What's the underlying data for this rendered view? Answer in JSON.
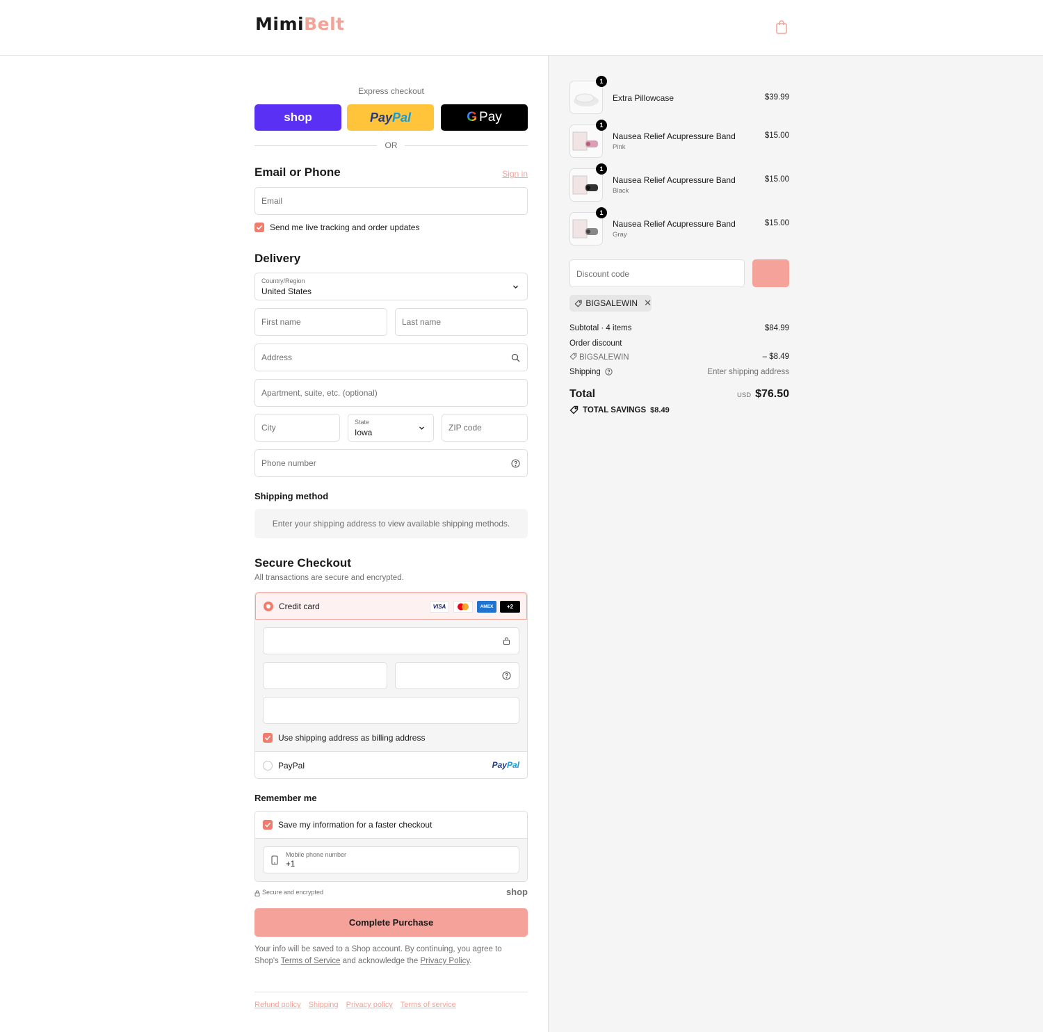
{
  "header": {
    "logo_part1": "Mimi",
    "logo_part2": "Belt",
    "cart_icon": "shopping-bag-icon"
  },
  "express": {
    "label": "Express checkout",
    "shop_label": "shop",
    "paypal_part1": "Pay",
    "paypal_part2": "Pal",
    "gpay_g": "G",
    "gpay_label": "Pay",
    "or_label": "OR"
  },
  "contact": {
    "title": "Email or Phone",
    "sign_in": "Sign in",
    "email_placeholder": "Email",
    "updates_label": "Send me live tracking and order updates",
    "updates_checked": true
  },
  "delivery": {
    "title": "Delivery",
    "country_label": "Country/Region",
    "country_value": "United States",
    "first_name_placeholder": "First name",
    "last_name_placeholder": "Last name",
    "address_placeholder": "Address",
    "apartment_placeholder": "Apartment, suite, etc. (optional)",
    "city_placeholder": "City",
    "state_label": "State",
    "state_value": "Iowa",
    "zip_placeholder": "ZIP code",
    "phone_placeholder": "Phone number"
  },
  "shipping_method": {
    "title": "Shipping method",
    "note": "Enter your shipping address to view available shipping methods."
  },
  "payment": {
    "title": "Secure Checkout",
    "subtitle": "All transactions are secure and encrypted.",
    "credit_card_label": "Credit card",
    "card_logos": [
      "VISA",
      "",
      "AMEX",
      "+2"
    ],
    "billing_label": "Use shipping address as billing address",
    "billing_checked": true,
    "paypal_label": "PayPal",
    "paypal_logo_part1": "Pay",
    "paypal_logo_part2": "Pal"
  },
  "remember": {
    "title": "Remember me",
    "save_label": "Save my information for a faster checkout",
    "save_checked": true,
    "mobile_label": "Mobile phone number",
    "mobile_value": "+1"
  },
  "secure_note": "Secure and encrypted",
  "shop_mini": "shop",
  "complete_button": "Complete Purchase",
  "legal": {
    "text1": "Your info will be saved to a Shop account. By continuing, you agree to Shop's ",
    "terms_link": "Terms of Service",
    "text2": " and acknowledge the ",
    "privacy_link": "Privacy Policy",
    "text3": "."
  },
  "footer_links": [
    "Refund policy",
    "Shipping",
    "Privacy policy",
    "Terms of service"
  ],
  "cart": {
    "items": [
      {
        "name": "Extra Pillowcase",
        "variant": "",
        "price": "$39.99",
        "qty": "1"
      },
      {
        "name": "Nausea Relief Acupressure Band",
        "variant": "Pink",
        "price": "$15.00",
        "qty": "1"
      },
      {
        "name": "Nausea Relief Acupressure Band",
        "variant": "Black",
        "price": "$15.00",
        "qty": "1"
      },
      {
        "name": "Nausea Relief Acupressure Band",
        "variant": "Gray",
        "price": "$15.00",
        "qty": "1"
      }
    ],
    "discount_placeholder": "Discount code",
    "applied_code": "BIGSALEWIN",
    "subtotal_label": "Subtotal · 4 items",
    "subtotal_value": "$84.99",
    "order_discount_label": "Order discount",
    "discount_code": "BIGSALEWIN",
    "discount_value": "– $8.49",
    "shipping_label": "Shipping",
    "shipping_value": "Enter shipping address",
    "total_label": "Total",
    "currency": "USD",
    "total_value": "$76.50",
    "savings_label": "TOTAL SAVINGS",
    "savings_value": "$8.49"
  },
  "colors": {
    "accent": "#f2a498",
    "accent_strong": "#f07c6e",
    "button": "#f5a39a",
    "shop_purple": "#5a31f4",
    "paypal_yellow": "#ffc439"
  }
}
